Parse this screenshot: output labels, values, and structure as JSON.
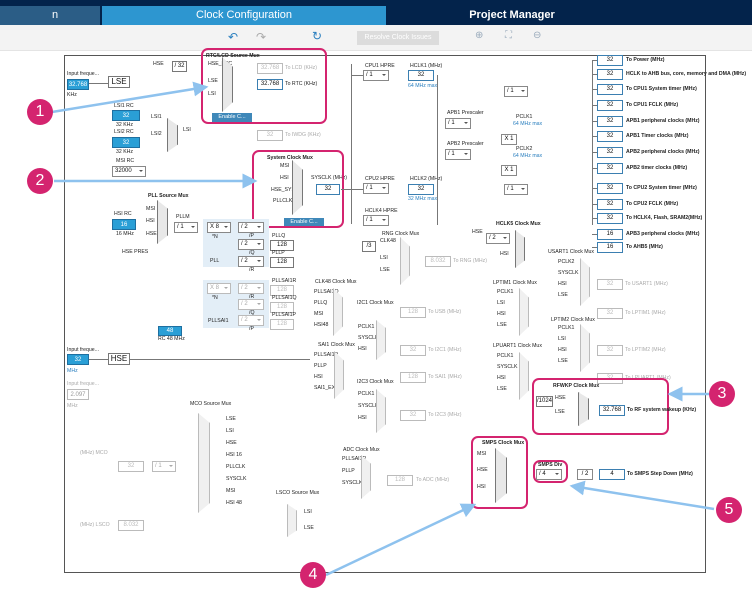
{
  "tabs": {
    "partial": "n",
    "clock": "Clock Configuration",
    "project": "Project Manager"
  },
  "toolbar": {
    "undo": "↶",
    "redo": "↷",
    "refresh": "↻",
    "resolve": "Resolve Clock Issues",
    "zoom_in": "⊕",
    "fit": "⛶",
    "zoom_out": "⊖"
  },
  "callouts": [
    "1",
    "2",
    "3",
    "4",
    "5"
  ],
  "input_lse": {
    "label": "Input freque...",
    "value": "32.768",
    "unit": "KHz",
    "name": "LSE"
  },
  "lsi1": {
    "label": "LSI1 RC",
    "value": "32",
    "unit": "32 KHz",
    "name": "LSI1"
  },
  "lsi2": {
    "label": "LSI2 RC",
    "value": "32",
    "unit": "32 KHz",
    "name": "LSI2"
  },
  "lsi_mux_label": "LSI",
  "msi": {
    "label": "MSI RC",
    "value": "32000"
  },
  "hsi": {
    "label": "HSI RC",
    "value": "16",
    "unit": "16 MHz"
  },
  "hse_pres": "HSE PRES",
  "input_hse": {
    "label": "Input freque...",
    "value": "32",
    "unit": "MHz",
    "name": "HSE"
  },
  "input_gray": {
    "label": "Input freque...",
    "value": "2.097",
    "unit": "MHz"
  },
  "rc48": {
    "value": "48",
    "label": "RC 48 MHz"
  },
  "rtc_mux": {
    "title": "RTC/LCD Source Mux",
    "hse_rtc": "HSE_RTC",
    "lse": "LSE",
    "lsi": "LSI",
    "hse_div": "/ 32",
    "lcd_value": "32.768",
    "lcd_label": "To LCD (KHz)",
    "rtc_value": "32.768",
    "rtc_label": "To RTC (KHz)",
    "enable": "Enable C...",
    "iwdg_value": "32",
    "iwdg_label": "To IWDG (KHz)",
    "hse": "HSE"
  },
  "sys_mux": {
    "title": "System Clock Mux",
    "msi": "MSI",
    "hsi": "HSI",
    "hse_sys": "HSE_SYS",
    "pllclk": "PLLCLK",
    "sysclk_label": "SYSCLK (MHz)",
    "sysclk_value": "32",
    "enable": "Enable C..."
  },
  "pll": {
    "title": "PLL Source Mux",
    "msi": "MSI",
    "hsi": "HSI",
    "hse": "HSE",
    "pllm_label": "PLLM",
    "pllm": "/ 1",
    "pll_label": "PLL",
    "n": "X 8",
    "n_label": "*N",
    "p": "/ 2",
    "p_label": "/P",
    "q": "/ 2",
    "q_label": "/Q",
    "r": "/ 2",
    "r_label": "/R",
    "pllq_label": "PLLQ",
    "pllq_value": "128",
    "pllp_label": "PLLP",
    "pllp_value": "128",
    "sai1_label": "PLLSAI1",
    "sai1_n": "X 8",
    "sai1_p": "/ 2",
    "sai1_q": "/ 2",
    "sai1_r": "/ 2",
    "sai1r_label": "PLLSAI1R",
    "sai1q_label": "PLLSAI1Q",
    "sai1p_label": "PLLSAI1P",
    "sai1r_value": "128",
    "sai1q_value": "128",
    "sai1p_value": "128"
  },
  "cpu1": {
    "hpre_label": "CPU1 HPRE",
    "hpre": "/ 1",
    "hclk_label": "HCLK1 (MHz)",
    "hclk": "32",
    "max": "64 MHz max"
  },
  "outputs": [
    {
      "value": "32",
      "label": "To Power (MHz)"
    },
    {
      "value": "32",
      "label": "HCLK to AHB bus, core, memory and DMA (MHz)"
    },
    {
      "value": "32",
      "label": "To CPU1 System timer (MHz)"
    },
    {
      "value": "32",
      "label": "To CPU1 FCLK (MHz)"
    },
    {
      "value": "32",
      "label": "APB1 peripheral clocks (MHz)"
    },
    {
      "value": "32",
      "label": "APB1 Timer clocks (MHz)"
    },
    {
      "value": "32",
      "label": "APB2 peripheral clocks (MHz)"
    },
    {
      "value": "32",
      "label": "APB2 timer clocks (MHz)"
    },
    {
      "value": "32",
      "label": "To CPU2 System timer (MHz)"
    },
    {
      "value": "32",
      "label": "To CPU2 FCLK (MHz)"
    },
    {
      "value": "32",
      "label": "To HCLK4, Flash, SRAM2(MHz)"
    },
    {
      "value": "16",
      "label": "APB3 peripheral clocks (MHz)"
    },
    {
      "value": "16",
      "label": "To AHB5 (MHz)"
    }
  ],
  "systimer_div": "/ 1",
  "apb1": {
    "label": "APB1 Prescaler",
    "value": "/ 1",
    "pclk": "PCLK1",
    "max": "64 MHz max",
    "x": "X 1"
  },
  "apb2": {
    "label": "APB2 Prescaler",
    "value": "/ 1",
    "pclk": "PCLK2",
    "max": "64 MHz max",
    "x": "X 1"
  },
  "cpu2": {
    "hpre_label": "CPU2 HPRE",
    "hpre": "/ 1",
    "hclk_label": "HCLK2 (MHz)",
    "hclk": "32",
    "max": "32 MHz max",
    "div": "/ 1"
  },
  "hclk4": {
    "label": "HCLK4 HPRE",
    "value": "/ 1"
  },
  "rng": {
    "title": "RNG Clock Mux",
    "clk48": "CLK48",
    "lsi": "LSI",
    "lse": "LSE",
    "div": "/3",
    "value": "8.032",
    "label": "To RNG (MHz)"
  },
  "hclk5": {
    "title": "HCLK5 Clock Mux",
    "hse": "HSE",
    "hsi": "HSI",
    "div": "/ 2"
  },
  "clk48": {
    "title": "CLK48 Clock Mux",
    "in": [
      "PLLSAI1Q",
      "PLLQ",
      "MSI",
      "HSI48"
    ]
  },
  "i2c1": {
    "title": "I2C1 Clock Mux",
    "in": [
      "PCLK1",
      "SYSCLK",
      "HSI"
    ],
    "value": "32",
    "label": "To I2C1 (MHz)"
  },
  "usb": {
    "value": "128",
    "label": "To USB (MHz)"
  },
  "sai1": {
    "title": "SAI1 Clock Mux",
    "in": [
      "PLLSAI1P",
      "PLLP",
      "HSI",
      "SAI1_EXT"
    ],
    "value": "128",
    "label": "To SAI1 (MHz)"
  },
  "i2c3": {
    "title": "I2C3 Clock Mux",
    "in": [
      "PCLK1",
      "SYSCLK",
      "HSI"
    ],
    "value": "32",
    "label": "To I2C3 (MHz)"
  },
  "usart1": {
    "title": "USART1 Clock Mux",
    "in": [
      "PCLK2",
      "SYSCLK",
      "HSI",
      "LSE"
    ],
    "value": "32",
    "label": "To USART1 (MHz)"
  },
  "lptim1": {
    "title": "LPTIM1 Clock Mux",
    "in": [
      "PCLK1",
      "LSI",
      "HSI",
      "LSE"
    ],
    "value": "32",
    "label": "To LPTIM1 (MHz)"
  },
  "lptim2": {
    "title": "LPTIM2 Clock Mux",
    "in": [
      "PCLK1",
      "LSI",
      "HSI",
      "LSE"
    ],
    "value": "32",
    "label": "To LPTIM2 (MHz)"
  },
  "lpuart1": {
    "title": "LPUART1 Clock Mux",
    "in": [
      "PCLK1",
      "SYSCLK",
      "HSI",
      "LSE"
    ],
    "value": "32",
    "label": "To LPUART1 (MHz)"
  },
  "rfwkp": {
    "title": "RFWKP Clock Mux",
    "div": "/1024",
    "hse": "HSE",
    "lse": "LSE",
    "value": "32.768",
    "label": "To RF system wakeup (KHz)"
  },
  "smps": {
    "title": "SMPS Clock Mux",
    "msi": "MSI",
    "hse": "HSE",
    "hsi": "HSI",
    "div_label": "SMPS Div",
    "div": "/ 4",
    "x": "/ 2",
    "value": "4",
    "label": "To SMPS Step Down (MHz)"
  },
  "mco": {
    "title": "MCO Source Mux",
    "in": [
      "LSE",
      "LSI",
      "HSE",
      "HSI 16",
      "PLLCLK",
      "SYSCLK",
      "MSI",
      "HSI 48"
    ],
    "label": "(MHz) MCO",
    "value": "32",
    "div": "/ 1"
  },
  "adc": {
    "title": "ADC Clock Mux",
    "in": [
      "PLLSAI1R",
      "PLLP",
      "SYSCLK"
    ],
    "value": "128",
    "label": "To ADC (MHz)"
  },
  "lsco": {
    "title": "LSCO Source Mux",
    "lsi": "LSI",
    "lse": "LSE",
    "label": "(MHz) LSCO",
    "value": "8.032"
  }
}
